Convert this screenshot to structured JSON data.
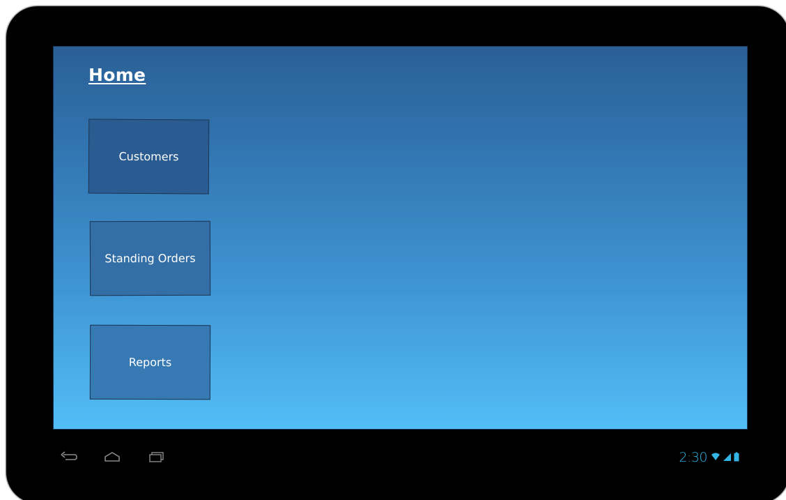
{
  "screen": {
    "title": "Home"
  },
  "menu": {
    "buttons": [
      {
        "label": "Customers"
      },
      {
        "label": "Standing Orders"
      },
      {
        "label": "Reports"
      }
    ]
  },
  "system_bar": {
    "clock": "2:30",
    "icons": [
      "back-icon",
      "home-icon",
      "recent-apps-icon",
      "wifi-icon",
      "signal-icon",
      "battery-icon"
    ]
  },
  "colors": {
    "frame": "#000000",
    "screen_top": "#2a5f96",
    "screen_bottom": "#52bdf6",
    "status_accent": "#33b5e5",
    "nav_icon": "#8a8a8a"
  }
}
